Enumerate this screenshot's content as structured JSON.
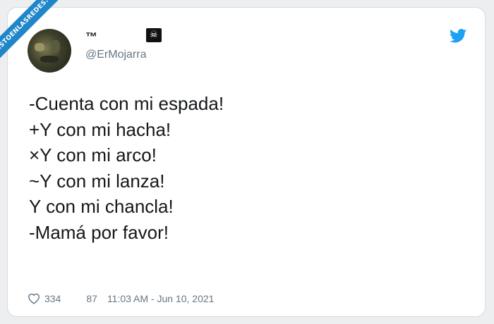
{
  "watermark": {
    "text": "VISTOENLASREDES.com"
  },
  "author": {
    "display_name": "™",
    "badge_icon": "skull-crossbones-icon",
    "handle": "@ErMojarra"
  },
  "tweet": {
    "lines": [
      "-Cuenta con mi espada!",
      "+Y con mi hacha!",
      "×Y con mi arco!",
      "~Y con mi lanza!",
      "Y con mi chancla!",
      "-Mamá por favor!"
    ]
  },
  "footer": {
    "likes": "334",
    "retweets": "87",
    "timestamp": "11:03 AM - Jun 10, 2021"
  },
  "colors": {
    "twitter_blue": "#1da1f2",
    "text": "#14171a",
    "muted": "#657786",
    "ribbon": "#1f86c9"
  }
}
